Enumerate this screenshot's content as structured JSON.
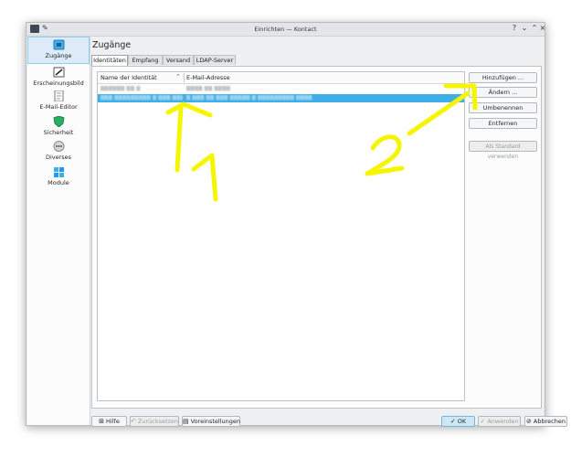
{
  "window": {
    "title": "Einrichten — Kontact"
  },
  "sidebar": {
    "items": [
      {
        "label": "Zugänge",
        "icon": "accounts-icon"
      },
      {
        "label": "Erscheinungsbild",
        "icon": "appearance-icon"
      },
      {
        "label": "E-Mail-Editor",
        "icon": "editor-icon"
      },
      {
        "label": "Sicherheit",
        "icon": "shield-icon"
      },
      {
        "label": "Diverses",
        "icon": "misc-icon"
      },
      {
        "label": "Module",
        "icon": "plugins-icon"
      }
    ]
  },
  "page": {
    "title": "Zugänge"
  },
  "tabs": [
    {
      "label": "Identitäten"
    },
    {
      "label": "Empfang"
    },
    {
      "label": "Versand"
    },
    {
      "label": "LDAP-Server"
    }
  ],
  "identities": {
    "columns": {
      "name": "Name der Identität",
      "email": "E-Mail-Adresse"
    },
    "rows": [
      {
        "name": "▒▒▒▒▒▒ ▒▒ ▒",
        "email": "▒▒▒▒ ▒▒ ▒▒▒▒",
        "selected": false
      },
      {
        "name": "▒▒▒ ▒▒▒▒▒▒▒▒▒ ▒ ▒▒▒ ▒▒▒▒▒▒▒▒▒▒▒▒",
        "email": "▒ ▒▒▒ ▒▒ ▒▒▒ ▒▒▒▒▒ ▒ ▒▒▒▒▒▒▒▒▒ ▒▒▒▒",
        "selected": true
      }
    ]
  },
  "actions": {
    "add": "Hinzufügen ...",
    "modify": "Ändern ...",
    "rename": "Umbenennen",
    "remove": "Entfernen",
    "set_default": "Als Standard verwenden"
  },
  "footer": {
    "help": "Hilfe",
    "reset": "Zurücksetzen",
    "defaults": "Voreinstellungen",
    "ok": "OK",
    "apply": "Anwenden",
    "cancel": "Abbrechen"
  },
  "annotations": {
    "arrow1_label": "1",
    "arrow2_label": "2",
    "color": "#f5f500"
  },
  "colors": {
    "selection": "#3daee9",
    "accent": "#93cee9"
  }
}
